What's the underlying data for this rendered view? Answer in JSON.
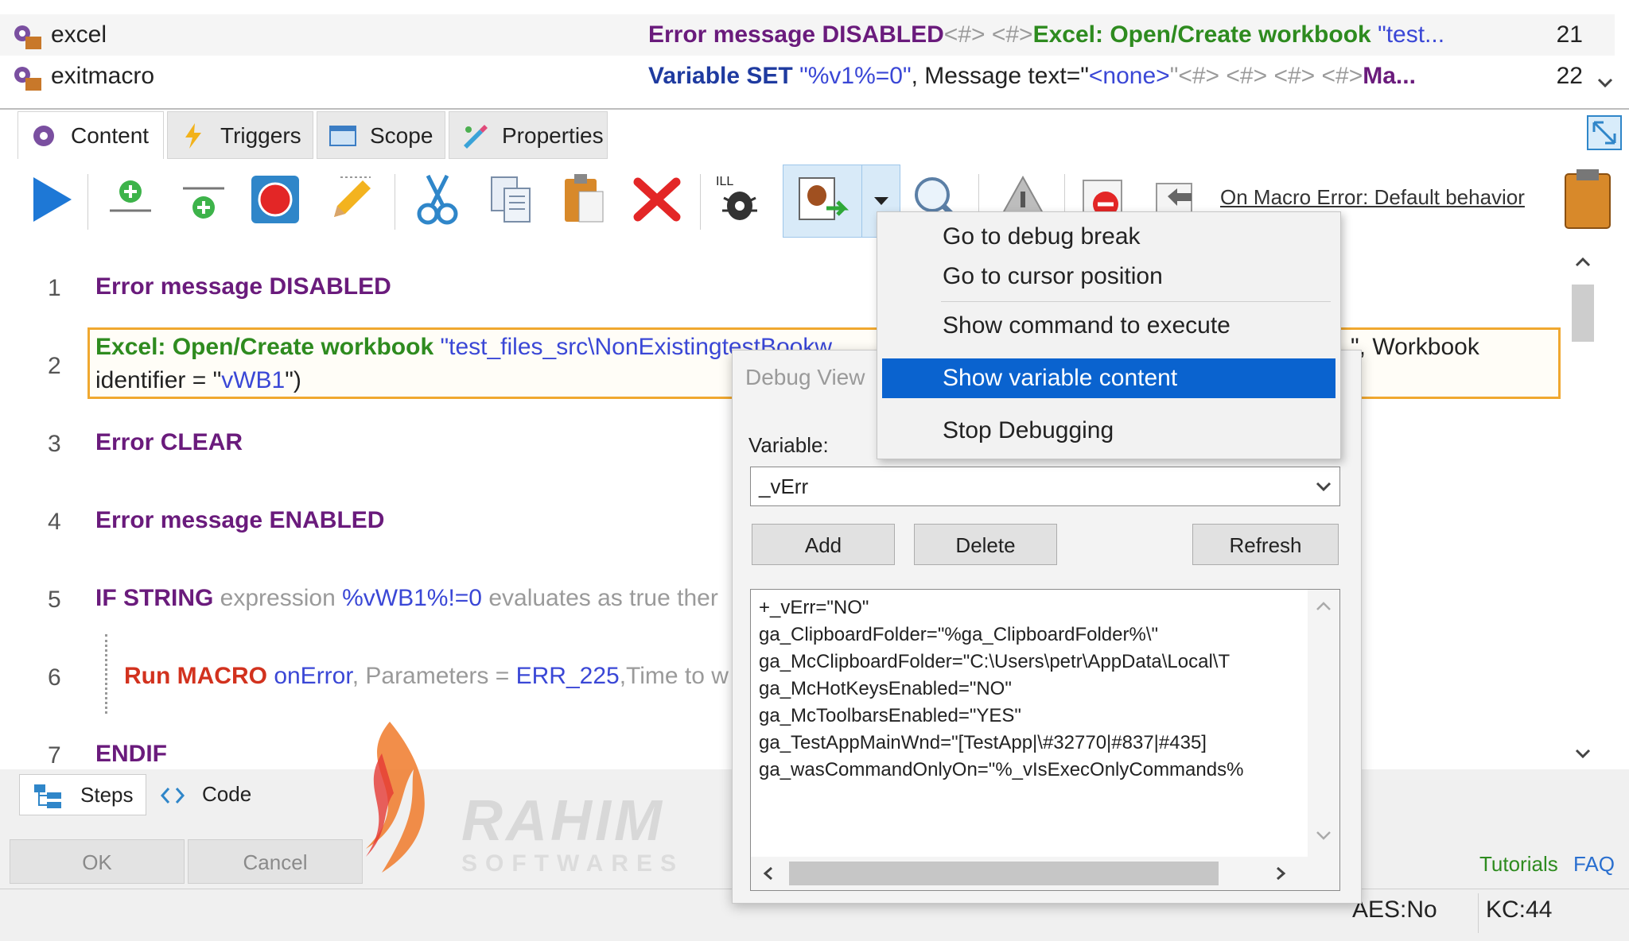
{
  "macro_list": {
    "rows": [
      {
        "name": "excel",
        "num": "21",
        "parts": [
          {
            "t": "Error message DISABLED",
            "c": "k-purple"
          },
          {
            "t": "<#> <#>",
            "c": "k-grey"
          },
          {
            "t": "Excel: Open/Create workbook",
            "c": "k-green"
          },
          {
            "t": " \"test...",
            "c": "k-link"
          }
        ]
      },
      {
        "name": "exitmacro",
        "num": "22",
        "parts": [
          {
            "t": "Variable SET ",
            "c": "k-blue"
          },
          {
            "t": "\"%v1%=0\"",
            "c": "k-link"
          },
          {
            "t": ", Message text=\"",
            "c": ""
          },
          {
            "t": "<none>",
            "c": "k-link"
          },
          {
            "t": "\"<#> <#> <#> <#>",
            "c": "k-grey"
          },
          {
            "t": "Ma...",
            "c": "k-purple"
          }
        ]
      }
    ]
  },
  "tabs": [
    {
      "label": "Content",
      "icon": "gear-icon"
    },
    {
      "label": "Triggers",
      "icon": "lightning-icon"
    },
    {
      "label": "Scope",
      "icon": "window-icon"
    },
    {
      "label": "Properties",
      "icon": "properties-icon"
    }
  ],
  "toolbar": {
    "on_error_link": "On Macro Error: Default behavior"
  },
  "editor": {
    "lines": [
      {
        "n": "1",
        "parts": [
          {
            "t": "Error message DISABLED",
            "c": "k-purple"
          }
        ]
      },
      {
        "n": "2",
        "parts": [
          {
            "t": "Excel: Open/Create workbook ",
            "c": "k-green"
          },
          {
            "t": "\"test_files_src\\NonExistingtestBookw",
            "c": "k-link"
          }
        ],
        "tail": "\", Workbook",
        "line2": [
          {
            "t": "identifier = \"",
            "c": ""
          },
          {
            "t": "vWB1",
            "c": "k-link"
          },
          {
            "t": "\")",
            "c": ""
          }
        ]
      },
      {
        "n": "3",
        "parts": [
          {
            "t": "Error CLEAR",
            "c": "k-purple"
          }
        ]
      },
      {
        "n": "4",
        "parts": [
          {
            "t": "Error message ENABLED",
            "c": "k-purple"
          }
        ]
      },
      {
        "n": "5",
        "parts": [
          {
            "t": "IF STRING ",
            "c": "k-purple"
          },
          {
            "t": "expression ",
            "c": "k-grey"
          },
          {
            "t": "%vWB1%!=0 ",
            "c": "k-link"
          },
          {
            "t": "evaluates as true ther",
            "c": "k-grey"
          }
        ]
      },
      {
        "n": "6",
        "parts": [
          {
            "t": "Run MACRO ",
            "c": "k-red"
          },
          {
            "t": "onError",
            "c": "k-link"
          },
          {
            "t": ", Parameters = ",
            "c": "k-grey"
          },
          {
            "t": "ERR_225",
            "c": "k-link"
          },
          {
            "t": ",Time to w",
            "c": "k-grey"
          }
        ]
      },
      {
        "n": "7",
        "parts": [
          {
            "t": "ENDIF",
            "c": "k-purple"
          }
        ]
      }
    ]
  },
  "bottom_tabs": [
    {
      "label": "Steps"
    },
    {
      "label": "Code"
    }
  ],
  "bottom": {
    "ok": "OK",
    "cancel": "Cancel",
    "tutorials": "Tutorials",
    "faq": "FAQ",
    "status_aes": "AES:No",
    "status_kc": "KC:44",
    "watermark_main": "RAHIM",
    "watermark_sub": "SOFTWARES"
  },
  "debug": {
    "title": "Debug View",
    "variable_label": "Variable:",
    "selected": "_vErr",
    "add": "Add",
    "delete": "Delete",
    "refresh": "Refresh",
    "content": [
      "+_vErr=\"NO\"",
      "ga_ClipboardFolder=\"%ga_ClipboardFolder%\\\"",
      "ga_McClipboardFolder=\"C:\\Users\\petr\\AppData\\Local\\T",
      "ga_McHotKeysEnabled=\"NO\"",
      "ga_McToolbarsEnabled=\"YES\"",
      "ga_TestAppMainWnd=\"[TestApp|\\#32770|#837|#435]",
      "ga_wasCommandOnlyOn=\"%_vIsExecOnlyCommands%"
    ]
  },
  "menu": {
    "items": [
      {
        "label": "Go to debug break",
        "selected": false
      },
      {
        "label": "Go to cursor position",
        "selected": false
      },
      {
        "label": "Show command to execute",
        "selected": false
      },
      {
        "label": "Show variable content",
        "selected": true
      },
      {
        "label": "Stop Debugging",
        "selected": false
      }
    ]
  },
  "colors": {
    "accent": "#0a63cf",
    "highlight_border": "#f0a830"
  }
}
